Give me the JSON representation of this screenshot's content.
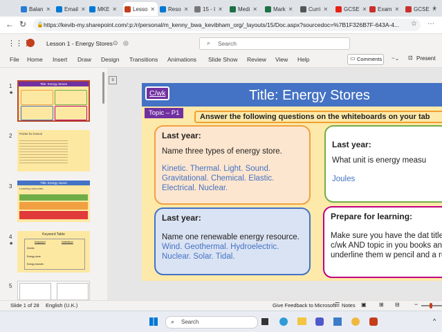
{
  "browser": {
    "tabs": [
      {
        "label": "Balan",
        "color": "#2b7cd3"
      },
      {
        "label": "Email",
        "color": "#0078d4"
      },
      {
        "label": "MKE",
        "color": "#0078d4"
      },
      {
        "label": "Lesso",
        "color": "#c43e1c",
        "active": true
      },
      {
        "label": "Reso",
        "color": "#0078d4"
      },
      {
        "label": "15 - I",
        "color": "#777"
      },
      {
        "label": "Medi",
        "color": "#1e7145"
      },
      {
        "label": "Mark",
        "color": "#1e7145"
      },
      {
        "label": "Curri",
        "color": "#555"
      },
      {
        "label": "GCSE",
        "color": "#e62117"
      },
      {
        "label": "Exam",
        "color": "#c9302c"
      },
      {
        "label": "GCSE",
        "color": "#c9302c"
      }
    ],
    "url": "https://kevib-my.sharepoint.com/:p:/r/personal/m_kenny_bwa_kevibham_org/_layouts/15/Doc.aspx?sourcedoc=%7B1F326B7F-643A-4..."
  },
  "app": {
    "doc_title": "Lesson 1 - Energy Stores",
    "search_placeholder": "Search",
    "menu": [
      "File",
      "Home",
      "Insert",
      "Draw",
      "Design",
      "Transitions",
      "Animations",
      "Slide Show",
      "Review",
      "View",
      "Help"
    ],
    "comments_label": "Comments",
    "present_label": "Present"
  },
  "thumbnails": [
    {
      "num": "1",
      "title": "Title: Energy Stores"
    },
    {
      "num": "2",
      "title": "Points for lesson"
    },
    {
      "num": "3",
      "title": "Title: Energy stores",
      "sub": "Learning outcomes:"
    },
    {
      "num": "4",
      "title": "Keyword Table",
      "col1": "Keyword",
      "col2": "Definition",
      "rows": [
        "Kinetic",
        "Energy store",
        "Energy transfer"
      ]
    },
    {
      "num": "5"
    }
  ],
  "slide": {
    "cwk": "C/wk",
    "title": "Title: Energy Stores",
    "topic": "Topic – P1",
    "instruction": "Answer the following questions on the whiteboards on your tab",
    "q1": {
      "heading": "Last year:",
      "question": "Name three types of energy store.",
      "answer": "Kinetic. Thermal. Light. Sound. Gravitational. Chemical. Elastic. Electrical. Nuclear."
    },
    "q2": {
      "heading": "Last year:",
      "question": "What unit is energy measu",
      "answer": "Joules"
    },
    "q3": {
      "heading": "Last year:",
      "question": "Name one renewable energy resource.",
      "answer": "Wind. Geothermal. Hydroelectric. Nuclear. Solar. Tidal."
    },
    "q4": {
      "heading": "Prepare for learning:",
      "text": "Make sure you have the dat title, c/wk AND topic in you books and underline them w pencil and a ruler."
    }
  },
  "status": {
    "slide_info": "Slide 1 of 28",
    "language": "English (U.K.)",
    "feedback": "Give Feedback to Microsoft",
    "notes": "Notes"
  },
  "taskbar": {
    "search_placeholder": "Search"
  }
}
